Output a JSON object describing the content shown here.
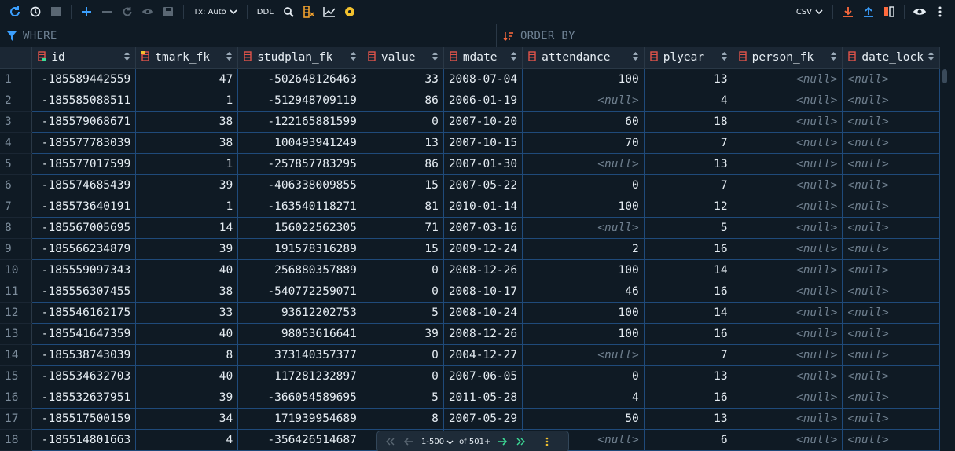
{
  "toolbar": {
    "tx_label": "Tx: Auto",
    "ddl_label": "DDL",
    "export_label": "CSV"
  },
  "filter": {
    "where_placeholder": "WHERE",
    "order_placeholder": "ORDER BY"
  },
  "columns": [
    {
      "name": "id",
      "icon": "primary-key-column-icon",
      "align": "num"
    },
    {
      "name": "tmark_fk",
      "icon": "foreign-key-column-icon",
      "align": "num"
    },
    {
      "name": "studplan_fk",
      "icon": "column-icon",
      "align": "num"
    },
    {
      "name": "value",
      "icon": "column-icon",
      "align": "num"
    },
    {
      "name": "mdate",
      "icon": "column-icon",
      "align": "txt"
    },
    {
      "name": "attendance",
      "icon": "column-icon",
      "align": "num"
    },
    {
      "name": "plyear",
      "icon": "column-icon",
      "align": "num"
    },
    {
      "name": "person_fk",
      "icon": "column-icon",
      "align": "num"
    },
    {
      "name": "date_lock",
      "icon": "column-icon",
      "align": "txt"
    }
  ],
  "null_text": "<null>",
  "rows": [
    [
      "1",
      "-185589442559",
      "47",
      "-502648126463",
      "33",
      "2008-07-04",
      "100",
      "13",
      "<null>",
      "<null>"
    ],
    [
      "2",
      "-185585088511",
      "1",
      "-512948709119",
      "86",
      "2006-01-19",
      "<null>",
      "4",
      "<null>",
      "<null>"
    ],
    [
      "3",
      "-185579068671",
      "38",
      "-122165881599",
      "0",
      "2007-10-20",
      "60",
      "18",
      "<null>",
      "<null>"
    ],
    [
      "4",
      "-185577783039",
      "38",
      "100493941249",
      "13",
      "2007-10-15",
      "70",
      "7",
      "<null>",
      "<null>"
    ],
    [
      "5",
      "-185577017599",
      "1",
      "-257857783295",
      "86",
      "2007-01-30",
      "<null>",
      "13",
      "<null>",
      "<null>"
    ],
    [
      "6",
      "-185574685439",
      "39",
      "-406338009855",
      "15",
      "2007-05-22",
      "0",
      "7",
      "<null>",
      "<null>"
    ],
    [
      "7",
      "-185573640191",
      "1",
      "-163540118271",
      "81",
      "2010-01-14",
      "100",
      "12",
      "<null>",
      "<null>"
    ],
    [
      "8",
      "-185567005695",
      "14",
      "156022562305",
      "71",
      "2007-03-16",
      "<null>",
      "5",
      "<null>",
      "<null>"
    ],
    [
      "9",
      "-185566234879",
      "39",
      "191578316289",
      "15",
      "2009-12-24",
      "2",
      "16",
      "<null>",
      "<null>"
    ],
    [
      "10",
      "-185559097343",
      "40",
      "256880357889",
      "0",
      "2008-12-26",
      "100",
      "14",
      "<null>",
      "<null>"
    ],
    [
      "11",
      "-185556307455",
      "38",
      "-540772259071",
      "0",
      "2008-10-17",
      "46",
      "16",
      "<null>",
      "<null>"
    ],
    [
      "12",
      "-185546162175",
      "33",
      "93612202753",
      "5",
      "2008-10-24",
      "100",
      "14",
      "<null>",
      "<null>"
    ],
    [
      "13",
      "-185541647359",
      "40",
      "98053616641",
      "39",
      "2008-12-26",
      "100",
      "16",
      "<null>",
      "<null>"
    ],
    [
      "14",
      "-185538743039",
      "8",
      "373140357377",
      "0",
      "2004-12-27",
      "<null>",
      "7",
      "<null>",
      "<null>"
    ],
    [
      "15",
      "-185534632703",
      "40",
      "117281232897",
      "0",
      "2007-06-05",
      "0",
      "13",
      "<null>",
      "<null>"
    ],
    [
      "16",
      "-185532637951",
      "39",
      "-366054589695",
      "5",
      "2011-05-28",
      "4",
      "16",
      "<null>",
      "<null>"
    ],
    [
      "17",
      "-185517500159",
      "34",
      "171939954689",
      "8",
      "2007-05-29",
      "50",
      "13",
      "<null>",
      "<null>"
    ],
    [
      "18",
      "-185514801663",
      "4",
      "-356426514687",
      "",
      "",
      "<null>",
      "6",
      "<null>",
      "<null>"
    ]
  ],
  "pager": {
    "range_label": "1-500",
    "total_label": "of 501+"
  },
  "colors": {
    "background": "#0f1a24",
    "header_bg": "#1b2734",
    "grid_line": "#1f4a7a",
    "accent_blue": "#3ba0ff",
    "accent_yellow": "#f2c12e",
    "key_icon_red": "#e0534a",
    "null_text": "#6f7f8e"
  }
}
